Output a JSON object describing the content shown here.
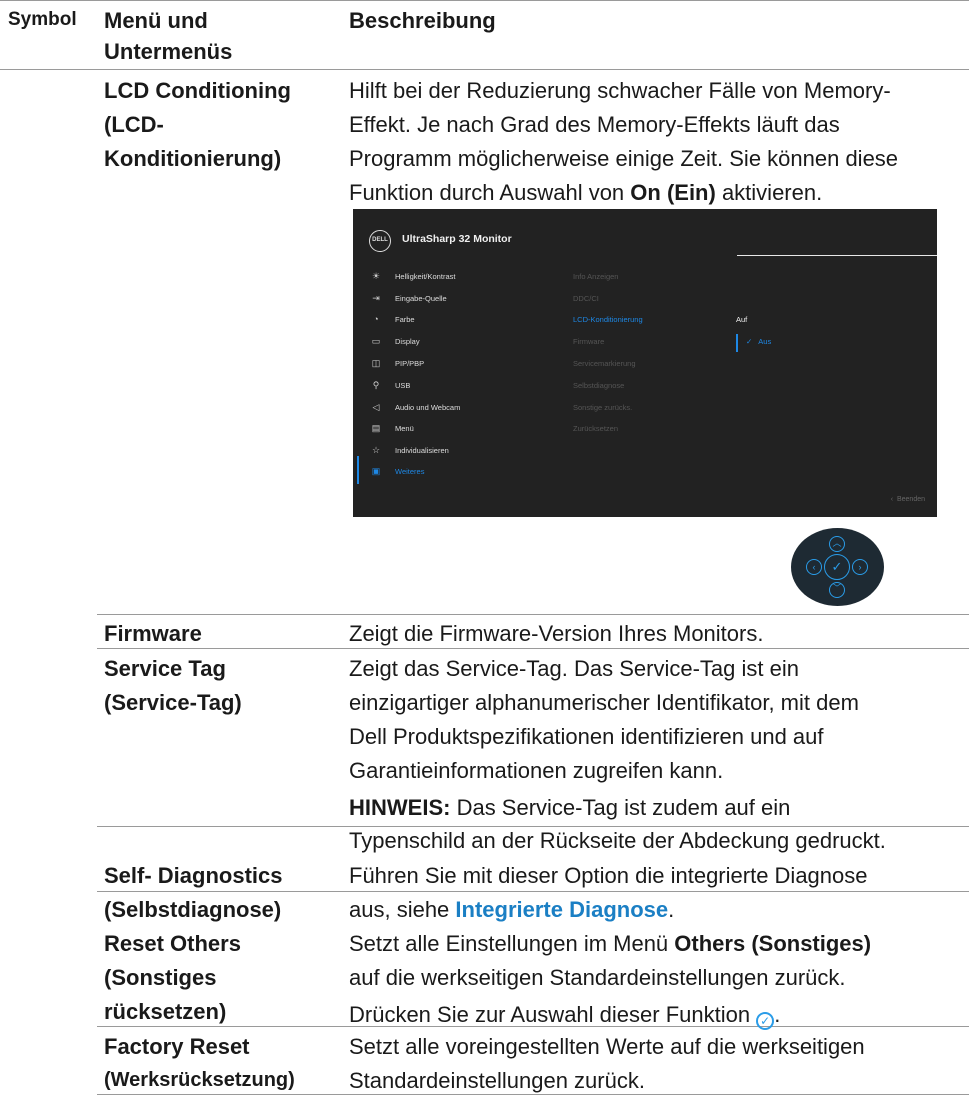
{
  "header": {
    "symbol": "Symbol",
    "menu_line1": "Menü und",
    "menu_line2": "Untermenüs",
    "description": "Beschreibung"
  },
  "lcd": {
    "label_line1": "LCD Conditioning",
    "label_line2": "(LCD-",
    "label_line3": "Konditionierung)",
    "desc_line1": "Hilft bei der Reduzierung schwacher Fälle von Memory-",
    "desc_line2": "Effekt. Je nach Grad des Memory-Effekts läuft das",
    "desc_line3": "Programm möglicherweise einige Zeit. Sie können diese",
    "desc_line4_pre": "Funktion durch Auswahl von ",
    "desc_line4_bold": "On (Ein)",
    "desc_line4_post": " aktivieren."
  },
  "osd": {
    "logo": "DELL",
    "title": "UltraSharp 32 Monitor",
    "menu": [
      {
        "icon": "sun-icon",
        "glyph": "☀",
        "label": "Helligkeit/Kontrast"
      },
      {
        "icon": "input-source-icon",
        "glyph": "⇥",
        "label": "Eingabe-Quelle"
      },
      {
        "icon": "color-palette-icon",
        "glyph": "◔",
        "label": "Farbe"
      },
      {
        "icon": "display-icon",
        "glyph": "▭",
        "label": "Display"
      },
      {
        "icon": "pip-pbp-icon",
        "glyph": "◫",
        "label": "PIP/PBP"
      },
      {
        "icon": "usb-icon",
        "glyph": "⚲",
        "label": "USB"
      },
      {
        "icon": "speaker-icon",
        "glyph": "◁",
        "label": "Audio und Webcam"
      },
      {
        "icon": "menu-icon",
        "glyph": "▤",
        "label": "Menü"
      },
      {
        "icon": "star-icon",
        "glyph": "☆",
        "label": "Individualisieren"
      },
      {
        "icon": "others-icon",
        "glyph": "▣",
        "label": "Weiteres"
      }
    ],
    "submenu": [
      "Info Anzeigen",
      "DDC/CI",
      "LCD-Konditionierung",
      "Firmware",
      "Servicemarkierung",
      "Selbstdiagnose",
      "Sonstige zurücks.",
      "Zurücksetzen"
    ],
    "option_on": "Auf",
    "option_off": "Aus",
    "exit": "Beenden",
    "colors": {
      "accent": "#1e88e5",
      "background": "#222222"
    }
  },
  "firmware": {
    "label": "Firmware",
    "desc": "Zeigt die Firmware-Version Ihres Monitors."
  },
  "service_tag": {
    "label_line1": "Service Tag",
    "label_line2": "(Service-Tag)",
    "desc_line1": "Zeigt das Service-Tag. Das Service-Tag ist ein",
    "desc_line2": "einzigartiger alphanumerischer Identifikator, mit dem",
    "desc_line3": "Dell Produktspezifikationen identifizieren und auf",
    "desc_line4": "Garantieinformationen zugreifen kann.",
    "note_bold": "HINWEIS:",
    "note_line1": " Das Service-Tag ist zudem auf ein",
    "note_line2": "Typenschild an der Rückseite der Abdeckung gedruckt."
  },
  "self_diag": {
    "label_line1": "Self- Diagnostics",
    "label_line2": "(Selbstdiagnose)",
    "desc_line1": "Führen Sie mit dieser Option die integrierte Diagnose",
    "desc_line2_pre": "aus, siehe ",
    "desc_line2_link": "Integrierte Diagnose",
    "desc_line2_post": "."
  },
  "reset_others": {
    "label_line1": "Reset Others",
    "label_line2": "(Sonstiges",
    "label_line3": "rücksetzen)",
    "desc_line1_pre": "Setzt alle Einstellungen im Menü ",
    "desc_line1_bold": "Others (Sonstiges)",
    "desc_line2": "auf die werkseitigen Standardeinstellungen zurück.",
    "desc_line3_pre": "Drücken Sie zur Auswahl dieser Funktion ",
    "desc_line3_post": "."
  },
  "factory_reset": {
    "label_line1": "Factory Reset",
    "label_line2": "(Werksrücksetzung)",
    "desc_line1": "Setzt alle voreingestellten Werte auf die werkseitigen",
    "desc_line2": "Standardeinstellungen zurück."
  }
}
